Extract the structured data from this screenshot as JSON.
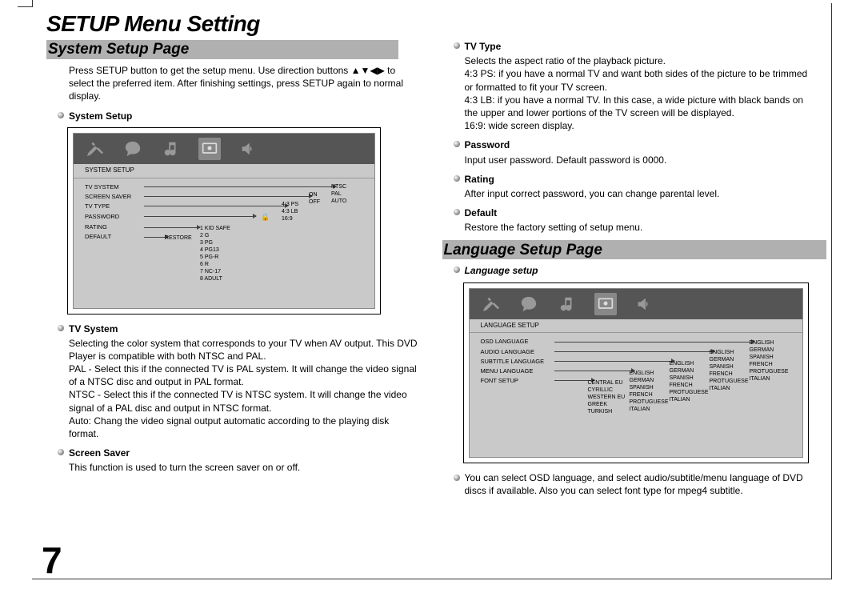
{
  "title": "SETUP Menu Setting",
  "page_number": "7",
  "left": {
    "section_bar": "System Setup Page",
    "intro": "Press SETUP button to get the setup menu. Use direction buttons ▲▼◀▶ to select the preferred item. After finishing settings, press SETUP again to normal display.",
    "bullets": {
      "system_setup": "System Setup",
      "tv_system": "TV System",
      "tv_system_text": "Selecting the color system that corresponds to your TV when AV output. This DVD Player is compatible with both NTSC and PAL.\nPAL - Select this if the connected TV is PAL system. It will change the video signal of a NTSC disc and output in PAL format.\nNTSC - Select this if the connected TV is NTSC system. It will change the video signal of a PAL disc and output in NTSC format.\nAuto: Chang the video signal output automatic according to the playing disk format.",
      "screen_saver": "Screen Saver",
      "screen_saver_text": "This function is used to turn the screen saver on or off."
    },
    "osd": {
      "heading": "SYSTEM SETUP",
      "items": [
        "TV SYSTEM",
        "SCREEN SAVER",
        "TV TYPE",
        "PASSWORD",
        "RATING",
        "DEFAULT"
      ],
      "restore": "RESTORE",
      "ratings": [
        "1 KID SAFE",
        "2 G",
        "3 PG",
        "4 PG13",
        "5 PG-R",
        "6 R",
        "7 NC-17",
        "8 ADULT"
      ],
      "tvtype_opts": [
        "4:3 PS",
        "4:3 LB",
        "16:9"
      ],
      "on_off": [
        "ON",
        "OFF"
      ],
      "tvsys_opts": [
        "NTSC",
        "PAL",
        "AUTO"
      ]
    }
  },
  "right": {
    "bullets": {
      "tv_type": "TV Type",
      "tv_type_text": "Selects the aspect ratio of the playback picture.\n4:3 PS: if you have a normal TV and want both sides of the picture to be trimmed or formatted to fit your TV screen.\n4:3 LB: if you have a normal TV. In this case, a wide picture with black bands on the upper and lower portions of the TV screen will be displayed.\n16:9: wide screen display.",
      "password": "Password",
      "password_text": "Input user password. Default password is 0000.",
      "rating": "Rating",
      "rating_text": "After input correct password, you can change parental level.",
      "default": "Default",
      "default_text": "Restore the factory setting of setup menu."
    },
    "section_bar": "Language Setup Page",
    "lang_head": "Language setup",
    "osd": {
      "heading": "LANGUAGE SETUP",
      "items": [
        "OSD LANGUAGE",
        "AUDIO LANGUAGE",
        "SUBTITLE LANGUAGE",
        "MENU LANGUAGE",
        "FONT  SETUP"
      ],
      "font_opts": [
        "CENTRAL EU",
        "CYRILLIC",
        "WESTERN EU",
        "GREEK",
        "TURKISH"
      ],
      "menu_opts": [
        "ENGLISH",
        "GERMAN",
        "SPANISH",
        "FRENCH",
        "PROTUGUESE",
        "ITALIAN"
      ],
      "sub_opts": [
        "ENGLISH",
        "GERMAN",
        "SPANISH",
        "FRENCH",
        "PROTUGUESE",
        "ITALIAN"
      ],
      "audio_opts": [
        "ENGLISH",
        "GERMAN",
        "SPANISH",
        "FRENCH",
        "PROTUGUESE",
        "ITALIAN"
      ],
      "osd_opts": [
        "ENGLISH",
        "GERMAN",
        "SPANISH",
        "FRENCH",
        "PROTUGUESE",
        "ITALIAN"
      ]
    },
    "lang_text": "You can select OSD language, and select audio/subtitle/menu language of DVD discs if available. Also you can select font type for mpeg4 subtitle."
  }
}
